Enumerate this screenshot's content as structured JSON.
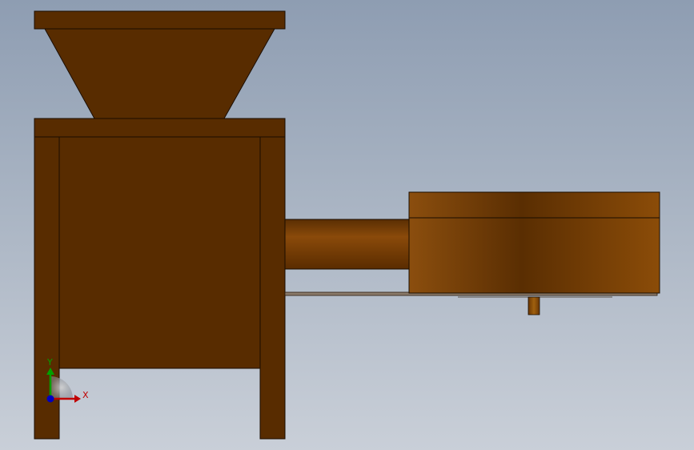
{
  "viewport": {
    "background_top": "#8e9db2",
    "background_bottom": "#c9cfd8"
  },
  "colors": {
    "frame_brown": "#582c00",
    "edge": "#1a0d00",
    "drum_light": "#8a4c0c",
    "drum_dark": "#5a2e02",
    "axis_x": "#c00000",
    "axis_y": "#00a000",
    "axis_z": "#0000c0"
  },
  "triad": {
    "x_label": "X",
    "y_label": "Y",
    "icon": "coordinate-triad-icon"
  }
}
